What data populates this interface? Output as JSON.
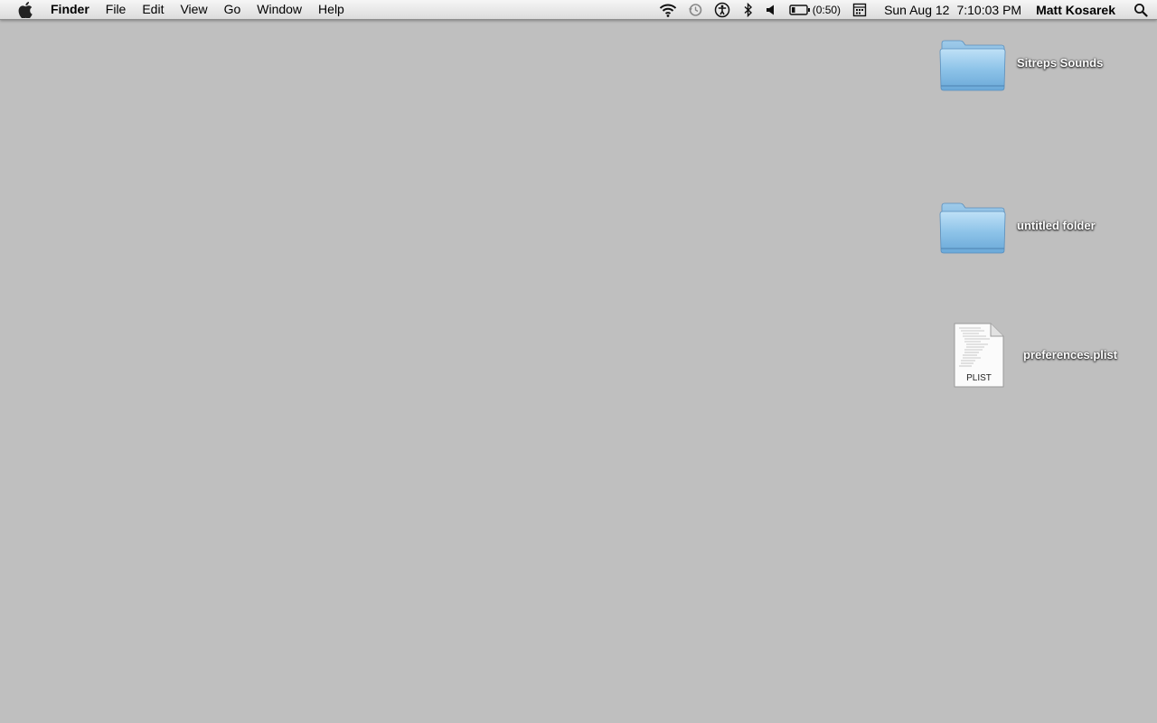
{
  "menubar": {
    "apple_icon": "apple-logo-icon",
    "app_name": "Finder",
    "menus": [
      "File",
      "Edit",
      "View",
      "Go",
      "Window",
      "Help"
    ],
    "status_icons": {
      "wifi": "wifi-icon",
      "time_machine": "time-machine-icon",
      "accessibility": "accessibility-icon",
      "bluetooth": "bluetooth-icon",
      "volume": "volume-icon",
      "battery": "battery-icon",
      "input_menu": "input-menu-icon",
      "spotlight": "spotlight-search-icon"
    },
    "battery_time": "(0:50)",
    "date": "Sun Aug 12",
    "time": "7:10:03 PM",
    "user_name": "Matt Kosarek"
  },
  "desktop": {
    "background_color": "#bfbfbf",
    "icons": [
      {
        "label": "Sitreps Sounds",
        "type": "folder-icon"
      },
      {
        "label": "untitled folder",
        "type": "folder-icon"
      },
      {
        "label": "preferences.plist",
        "type": "plist-document-icon",
        "badge": "PLIST"
      }
    ]
  }
}
